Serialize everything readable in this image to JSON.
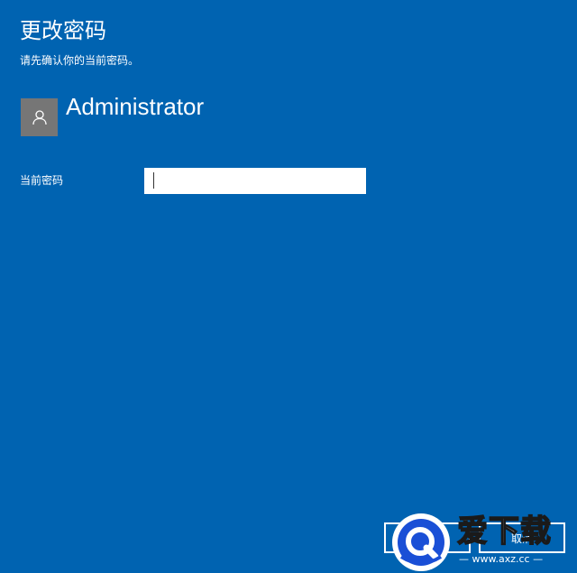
{
  "page": {
    "title": "更改密码",
    "subtitle": "请先确认你的当前密码。"
  },
  "account": {
    "name": "Administrator",
    "avatar_icon": "user-icon"
  },
  "form": {
    "current_password_label": "当前密码",
    "current_password_value": ""
  },
  "buttons": {
    "next_label": "下一步",
    "cancel_label": "取消"
  },
  "watermark": {
    "name": "爱下载",
    "url": "— www.axz.cc —"
  },
  "colors": {
    "background": "#0063b1",
    "text": "#ffffff",
    "avatar": "#767676",
    "input_bg": "#ffffff"
  }
}
